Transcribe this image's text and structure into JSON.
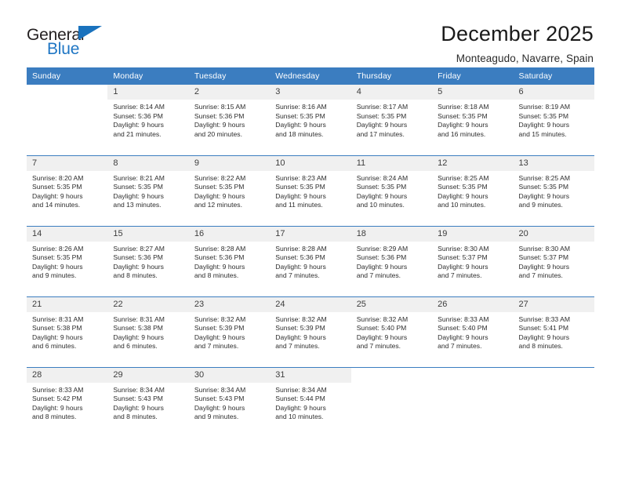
{
  "logo": {
    "word1": "General",
    "word2": "Blue",
    "triangle_color": "#1a72bd",
    "word2_color": "#1f76c4"
  },
  "header": {
    "title": "December 2025",
    "location": "Monteagudo, Navarre, Spain"
  },
  "theme": {
    "header_bg": "#3b7dc0",
    "daynum_bg": "#f0f0f0",
    "grid_line": "#3b7dc0"
  },
  "weekday_headers": [
    "Sunday",
    "Monday",
    "Tuesday",
    "Wednesday",
    "Thursday",
    "Friday",
    "Saturday"
  ],
  "weeks": [
    [
      {
        "day": "",
        "info": "",
        "blank": true
      },
      {
        "day": "1",
        "info": "Sunrise: 8:14 AM\nSunset: 5:36 PM\nDaylight: 9 hours\nand 21 minutes."
      },
      {
        "day": "2",
        "info": "Sunrise: 8:15 AM\nSunset: 5:36 PM\nDaylight: 9 hours\nand 20 minutes."
      },
      {
        "day": "3",
        "info": "Sunrise: 8:16 AM\nSunset: 5:35 PM\nDaylight: 9 hours\nand 18 minutes."
      },
      {
        "day": "4",
        "info": "Sunrise: 8:17 AM\nSunset: 5:35 PM\nDaylight: 9 hours\nand 17 minutes."
      },
      {
        "day": "5",
        "info": "Sunrise: 8:18 AM\nSunset: 5:35 PM\nDaylight: 9 hours\nand 16 minutes."
      },
      {
        "day": "6",
        "info": "Sunrise: 8:19 AM\nSunset: 5:35 PM\nDaylight: 9 hours\nand 15 minutes."
      }
    ],
    [
      {
        "day": "7",
        "info": "Sunrise: 8:20 AM\nSunset: 5:35 PM\nDaylight: 9 hours\nand 14 minutes."
      },
      {
        "day": "8",
        "info": "Sunrise: 8:21 AM\nSunset: 5:35 PM\nDaylight: 9 hours\nand 13 minutes."
      },
      {
        "day": "9",
        "info": "Sunrise: 8:22 AM\nSunset: 5:35 PM\nDaylight: 9 hours\nand 12 minutes."
      },
      {
        "day": "10",
        "info": "Sunrise: 8:23 AM\nSunset: 5:35 PM\nDaylight: 9 hours\nand 11 minutes."
      },
      {
        "day": "11",
        "info": "Sunrise: 8:24 AM\nSunset: 5:35 PM\nDaylight: 9 hours\nand 10 minutes."
      },
      {
        "day": "12",
        "info": "Sunrise: 8:25 AM\nSunset: 5:35 PM\nDaylight: 9 hours\nand 10 minutes."
      },
      {
        "day": "13",
        "info": "Sunrise: 8:25 AM\nSunset: 5:35 PM\nDaylight: 9 hours\nand 9 minutes."
      }
    ],
    [
      {
        "day": "14",
        "info": "Sunrise: 8:26 AM\nSunset: 5:35 PM\nDaylight: 9 hours\nand 9 minutes."
      },
      {
        "day": "15",
        "info": "Sunrise: 8:27 AM\nSunset: 5:36 PM\nDaylight: 9 hours\nand 8 minutes."
      },
      {
        "day": "16",
        "info": "Sunrise: 8:28 AM\nSunset: 5:36 PM\nDaylight: 9 hours\nand 8 minutes."
      },
      {
        "day": "17",
        "info": "Sunrise: 8:28 AM\nSunset: 5:36 PM\nDaylight: 9 hours\nand 7 minutes."
      },
      {
        "day": "18",
        "info": "Sunrise: 8:29 AM\nSunset: 5:36 PM\nDaylight: 9 hours\nand 7 minutes."
      },
      {
        "day": "19",
        "info": "Sunrise: 8:30 AM\nSunset: 5:37 PM\nDaylight: 9 hours\nand 7 minutes."
      },
      {
        "day": "20",
        "info": "Sunrise: 8:30 AM\nSunset: 5:37 PM\nDaylight: 9 hours\nand 7 minutes."
      }
    ],
    [
      {
        "day": "21",
        "info": "Sunrise: 8:31 AM\nSunset: 5:38 PM\nDaylight: 9 hours\nand 6 minutes."
      },
      {
        "day": "22",
        "info": "Sunrise: 8:31 AM\nSunset: 5:38 PM\nDaylight: 9 hours\nand 6 minutes."
      },
      {
        "day": "23",
        "info": "Sunrise: 8:32 AM\nSunset: 5:39 PM\nDaylight: 9 hours\nand 7 minutes."
      },
      {
        "day": "24",
        "info": "Sunrise: 8:32 AM\nSunset: 5:39 PM\nDaylight: 9 hours\nand 7 minutes."
      },
      {
        "day": "25",
        "info": "Sunrise: 8:32 AM\nSunset: 5:40 PM\nDaylight: 9 hours\nand 7 minutes."
      },
      {
        "day": "26",
        "info": "Sunrise: 8:33 AM\nSunset: 5:40 PM\nDaylight: 9 hours\nand 7 minutes."
      },
      {
        "day": "27",
        "info": "Sunrise: 8:33 AM\nSunset: 5:41 PM\nDaylight: 9 hours\nand 8 minutes."
      }
    ],
    [
      {
        "day": "28",
        "info": "Sunrise: 8:33 AM\nSunset: 5:42 PM\nDaylight: 9 hours\nand 8 minutes."
      },
      {
        "day": "29",
        "info": "Sunrise: 8:34 AM\nSunset: 5:43 PM\nDaylight: 9 hours\nand 8 minutes."
      },
      {
        "day": "30",
        "info": "Sunrise: 8:34 AM\nSunset: 5:43 PM\nDaylight: 9 hours\nand 9 minutes."
      },
      {
        "day": "31",
        "info": "Sunrise: 8:34 AM\nSunset: 5:44 PM\nDaylight: 9 hours\nand 10 minutes."
      },
      {
        "day": "",
        "info": "",
        "blank": true
      },
      {
        "day": "",
        "info": "",
        "blank": true
      },
      {
        "day": "",
        "info": "",
        "blank": true
      }
    ]
  ]
}
